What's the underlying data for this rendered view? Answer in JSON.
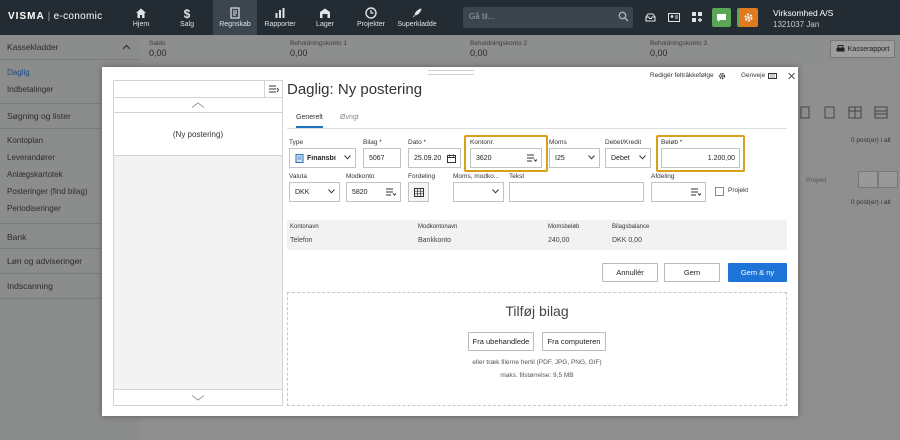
{
  "topbar": {
    "brand": "VISMA",
    "product": "e-conomic",
    "nav": [
      {
        "label": "Hjem",
        "icon": "home-icon"
      },
      {
        "label": "Salg",
        "icon": "dollar-icon"
      },
      {
        "label": "Regnskab",
        "icon": "ledger-icon"
      },
      {
        "label": "Rapporter",
        "icon": "bar-chart-icon"
      },
      {
        "label": "Lager",
        "icon": "warehouse-icon"
      },
      {
        "label": "Projekter",
        "icon": "clock-icon"
      },
      {
        "label": "Superkladde",
        "icon": "rocket-icon"
      }
    ],
    "search_placeholder": "Gå til...",
    "company_name": "Virksomhed A/S",
    "company_id": "1321037 Jan"
  },
  "sidebar": {
    "items": [
      {
        "label": "Kassekladder",
        "type": "head"
      },
      {
        "label": "Daglig",
        "type": "active"
      },
      {
        "label": "Indbetalinger",
        "type": "item"
      },
      {
        "label": "Søgning og lister",
        "type": "head"
      },
      {
        "label": "Kontoplan",
        "type": "item"
      },
      {
        "label": "Leverandører",
        "type": "item"
      },
      {
        "label": "Anlægskartotek",
        "type": "item"
      },
      {
        "label": "Posteringer (find bilag)",
        "type": "item"
      },
      {
        "label": "Periodiseringer",
        "type": "item"
      },
      {
        "label": "Bank",
        "type": "head"
      },
      {
        "label": "Løn og adviseringer",
        "type": "head"
      },
      {
        "label": "Indscanning",
        "type": "head"
      }
    ]
  },
  "balances": [
    {
      "label": "Saldo",
      "value": "0,00"
    },
    {
      "label": "Beholdningskonto 1",
      "value": "0,00"
    },
    {
      "label": "Beholdningskonto 2",
      "value": "0,00"
    },
    {
      "label": "Beholdningskonto 3",
      "value": "0,00"
    }
  ],
  "background": {
    "kasserapport_label": "Kasserapport",
    "posts_count_1": "0 post(er) i alt",
    "posts_count_2": "0 post(er) i alt",
    "projekt_col": "Projekt"
  },
  "modal": {
    "title": "Daglig: Ny postering",
    "edit_order_label": "Redigér felträkkefølge",
    "shortcuts_label": "Genveje",
    "left_panel_item": "(Ny postering)",
    "tabs": [
      {
        "label": "Generelt",
        "active": true
      },
      {
        "label": "Øvrigt",
        "active": false
      }
    ],
    "fields": {
      "type": {
        "label": "Type",
        "value": "Finansbi"
      },
      "bilag": {
        "label": "Bilag *",
        "value": "5067"
      },
      "dato": {
        "label": "Dato *",
        "value": "25.09.20"
      },
      "kontonr": {
        "label": "Kontonr.",
        "value": "3620"
      },
      "moms": {
        "label": "Moms",
        "value": "I25"
      },
      "debet_kredit": {
        "label": "Debet/Kredit",
        "value": "Debet"
      },
      "belob": {
        "label": "Beløb *",
        "value": "1.200,00"
      },
      "valuta": {
        "label": "Valuta",
        "value": "DKK"
      },
      "modkonto": {
        "label": "Modkonto",
        "value": "5820"
      },
      "fordeling": {
        "label": "Fordeling",
        "value": ""
      },
      "moms_modkonto": {
        "label": "Moms, modko...",
        "value": ""
      },
      "tekst": {
        "label": "Tekst",
        "value": ""
      },
      "afdeling": {
        "label": "Afdeling",
        "value": ""
      },
      "projekt": {
        "label": "Projekt",
        "checked": false
      }
    },
    "summary": {
      "headers": [
        "Kontonavn",
        "Modkontonavn",
        "Momsbeløb",
        "Bilagsbalance"
      ],
      "values": [
        "Telefon",
        "Bankkonto",
        "240,00",
        "DKK 0,00"
      ]
    },
    "buttons": {
      "cancel": "Annullér",
      "save": "Gem",
      "save_new": "Gem & ny"
    },
    "upload": {
      "title": "Tilføj bilag",
      "btn_unprocessed": "Fra ubehandlede",
      "btn_computer": "Fra computeren",
      "hint": "eller træk filerne hertil (PDF, JPG, PNG, GIF)",
      "max_size": "maks. filstørrelse: 9,5 MB"
    }
  },
  "colors": {
    "topbar": "#232c33",
    "primary": "#1e73d6",
    "highlight": "#d9a01a",
    "green_icon": "#5aa556",
    "orange_icon": "#e07a1f"
  }
}
